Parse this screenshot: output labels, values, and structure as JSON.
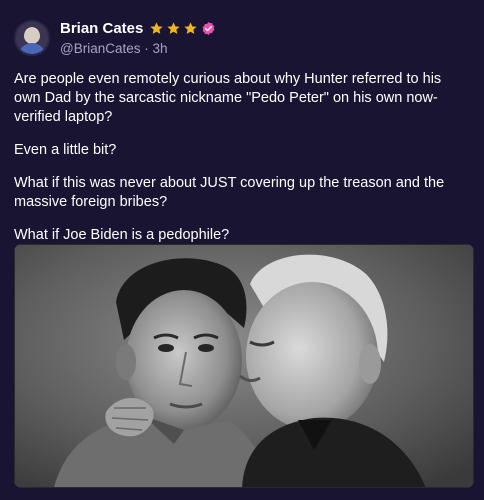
{
  "post": {
    "author": {
      "display_name": "Brian Cates",
      "handle": "@BrianCates",
      "separator": "·",
      "time": "3h"
    },
    "badges": {
      "stars": [
        "star-icon",
        "star-icon",
        "star-icon"
      ],
      "verified": "verified-badge-icon",
      "star_color": "#f2b51a",
      "verified_color": "#ec4fae"
    },
    "paragraphs": [
      "Are people even remotely curious about why Hunter referred to his own Dad by the sarcastic nickname \"Pedo Peter\" on his own now-verified laptop?",
      "Even a little bit?",
      "What if this was never about JUST covering up the treason and the massive foreign bribes?",
      "What if Joe Biden is a pedophile?"
    ],
    "media": {
      "type": "photo",
      "style": "black-and-white"
    }
  },
  "colors": {
    "background": "#1a1433",
    "text_primary": "#ffffff",
    "text_secondary": "#a9a3c4"
  }
}
